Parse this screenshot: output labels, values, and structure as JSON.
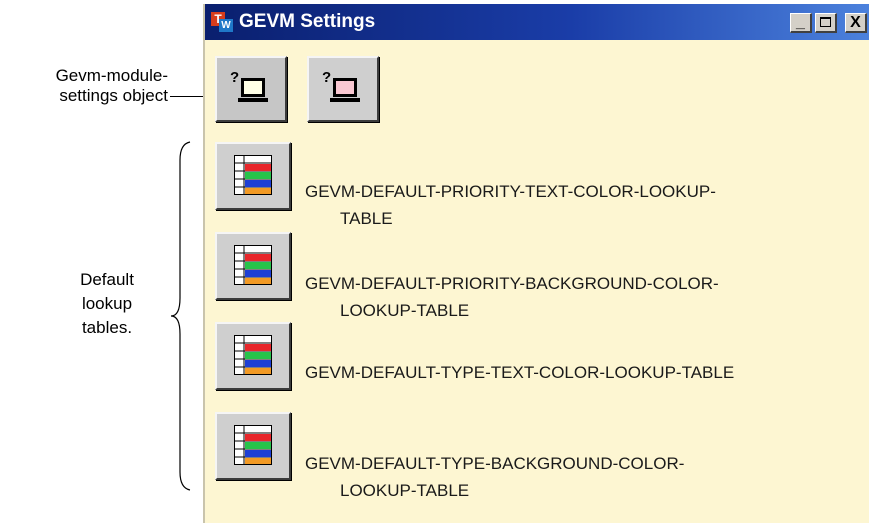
{
  "window": {
    "title": "GEVM Settings",
    "icon_letters": {
      "top": "T",
      "bottom": "W"
    },
    "controls": {
      "minimize": "_",
      "close": "X"
    }
  },
  "annotations": {
    "settings_object": [
      "Gevm-module-",
      "settings object"
    ],
    "default_tables": [
      "Default",
      "lookup",
      "tables."
    ]
  },
  "toolbar": [
    {
      "name": "gevm-module-settings-object",
      "icon": "computer-question-icon",
      "screen_color": "#ffffe6"
    },
    {
      "name": "gevm-module-settings-alt",
      "icon": "computer-question-icon",
      "screen_color": "#f9c8d2"
    }
  ],
  "lookup_tables": [
    {
      "lines": [
        "GEVM-DEFAULT-PRIORITY-TEXT-COLOR-LOOKUP-",
        "TABLE"
      ]
    },
    {
      "lines": [
        "GEVM-DEFAULT-PRIORITY-BACKGROUND-COLOR-",
        "LOOKUP-TABLE"
      ]
    },
    {
      "lines": [
        "GEVM-DEFAULT-TYPE-TEXT-COLOR-LOOKUP-TABLE"
      ]
    },
    {
      "lines": [
        "GEVM-DEFAULT-TYPE-BACKGROUND-COLOR-",
        "LOOKUP-TABLE"
      ]
    }
  ],
  "colors": {
    "window_bg": "#fdf6d2",
    "titlebar_start": "#0a1f6e",
    "titlebar_end": "#4c82dd",
    "table_red": "#e8262b",
    "table_green": "#27c34a",
    "table_blue": "#1e3fd4",
    "table_orange": "#f29a25"
  }
}
